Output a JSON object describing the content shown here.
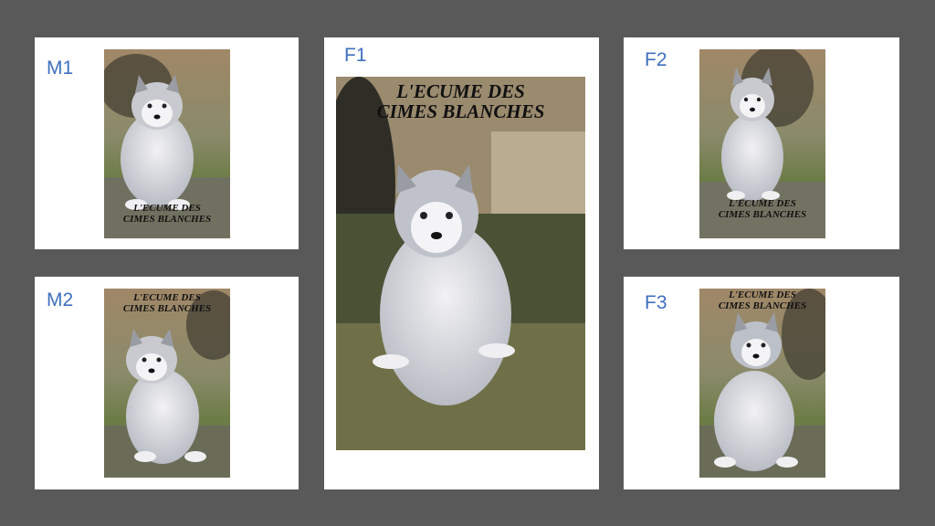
{
  "cards": [
    {
      "id": "m1",
      "label": "M1",
      "watermark": [
        "L'ECUME DES",
        "CIMES BLANCHES"
      ]
    },
    {
      "id": "m2",
      "label": "M2",
      "watermark": [
        "L'ECUME DES",
        "CIMES BLANCHES"
      ]
    },
    {
      "id": "f1",
      "label": "F1",
      "watermark": [
        "L'ECUME DES",
        "CIMES BLANCHES"
      ]
    },
    {
      "id": "f2",
      "label": "F2",
      "watermark": [
        "L'ECUME DES",
        "CIMES BLANCHES"
      ]
    },
    {
      "id": "f3",
      "label": "F3",
      "watermark": [
        "L'ECUME DES",
        "CIMES BLANCHES"
      ]
    }
  ],
  "colors": {
    "background": "#595959",
    "card": "#ffffff",
    "label": "#3f6fbf"
  },
  "photo_subject": "husky-puppy-photo"
}
